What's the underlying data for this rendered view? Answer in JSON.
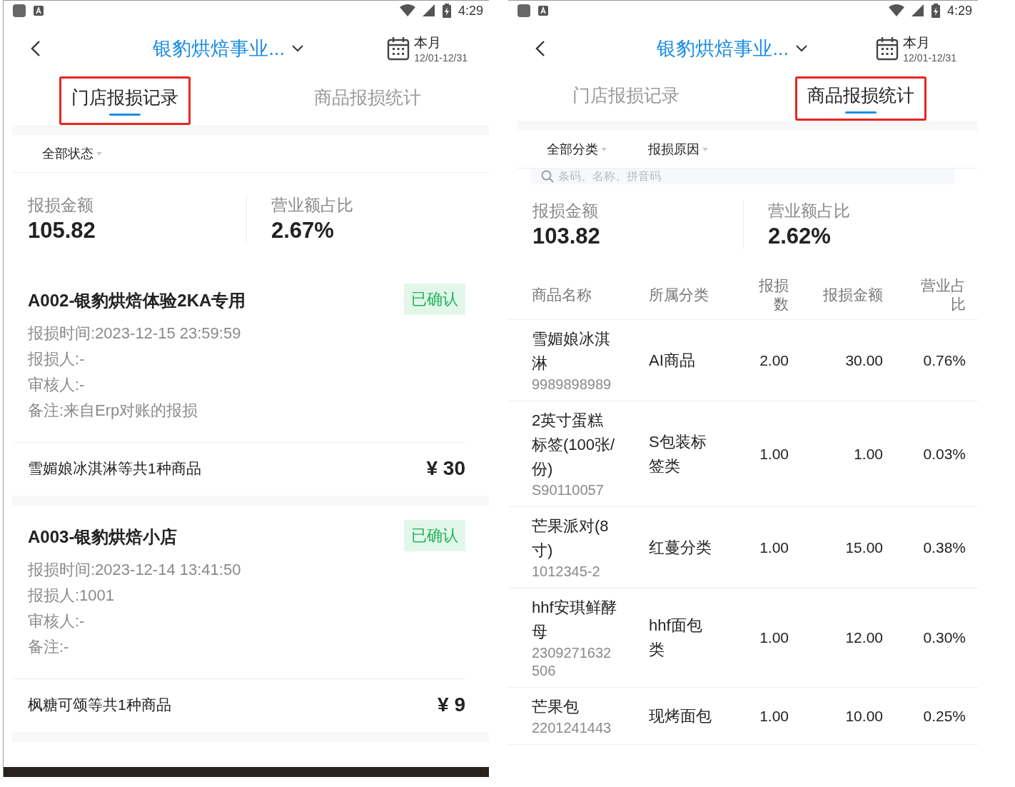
{
  "screens": [
    {
      "kind": "records",
      "status_bar": {
        "time": "4:29"
      },
      "header": {
        "title": "银豹烘焙事业...",
        "period": "本月",
        "date_range": "12/01-12/31"
      },
      "tabs": [
        {
          "label": "门店报损记录",
          "selected": true,
          "highlighted": true
        },
        {
          "label": "商品报损统计",
          "selected": false,
          "highlighted": false
        }
      ],
      "filters": [
        "全部状态"
      ],
      "summary": [
        {
          "label": "报损金额",
          "value": "105.82"
        },
        {
          "label": "营业额占比",
          "value": "2.67%"
        }
      ],
      "records": [
        {
          "title": "A002-银豹烘焙体验2KA专用",
          "status": "已确认",
          "lines": [
            "报损时间:2023-12-15 23:59:59",
            "报损人:-",
            "审核人:-",
            "备注:来自Erp对账的报损"
          ],
          "goods": "雪媚娘冰淇淋等共1种商品",
          "amount": "¥ 30"
        },
        {
          "title": "A003-银豹烘焙小店",
          "status": "已确认",
          "lines": [
            "报损时间:2023-12-14 13:41:50",
            "报损人:1001",
            "审核人:-",
            "备注:-"
          ],
          "goods": "枫糖可颂等共1种商品",
          "amount": "¥ 9"
        }
      ]
    },
    {
      "kind": "table",
      "status_bar": {
        "time": "4:29"
      },
      "header": {
        "title": "银豹烘焙事业...",
        "period": "本月",
        "date_range": "12/01-12/31"
      },
      "tabs": [
        {
          "label": "门店报损记录",
          "selected": false,
          "highlighted": false
        },
        {
          "label": "商品报损统计",
          "selected": true,
          "highlighted": true
        }
      ],
      "filters": [
        "全部分类",
        "报损原因"
      ],
      "search": {
        "placeholder": "条码、名称、拼音码"
      },
      "summary": [
        {
          "label": "报损金额",
          "value": "103.82"
        },
        {
          "label": "营业额占比",
          "value": "2.62%"
        }
      ],
      "table": {
        "columns": [
          "商品名称",
          "所属分类",
          "报损数",
          "报损金额",
          "营业占比"
        ],
        "rows": [
          {
            "name": "雪媚娘冰淇淋",
            "code": "9989898989",
            "category": "AI商品",
            "quantity": "2.00",
            "amount": "30.00",
            "share": "0.76%"
          },
          {
            "name": "2英寸蛋糕标签(100张/份)",
            "code": "S90110057",
            "category": "S包装标签类",
            "quantity": "1.00",
            "amount": "1.00",
            "share": "0.03%"
          },
          {
            "name": "芒果派对(8寸)",
            "code": "1012345-2",
            "category": "红蔓分类",
            "quantity": "1.00",
            "amount": "15.00",
            "share": "0.38%"
          },
          {
            "name": "hhf安琪鲜酵母",
            "code": "2309271632506",
            "category": "hhf面包类",
            "quantity": "1.00",
            "amount": "12.00",
            "share": "0.30%"
          },
          {
            "name": "芒果包",
            "code": "2201241443",
            "category": "现烤面包",
            "quantity": "1.00",
            "amount": "10.00",
            "share": "0.25%"
          }
        ]
      }
    }
  ]
}
